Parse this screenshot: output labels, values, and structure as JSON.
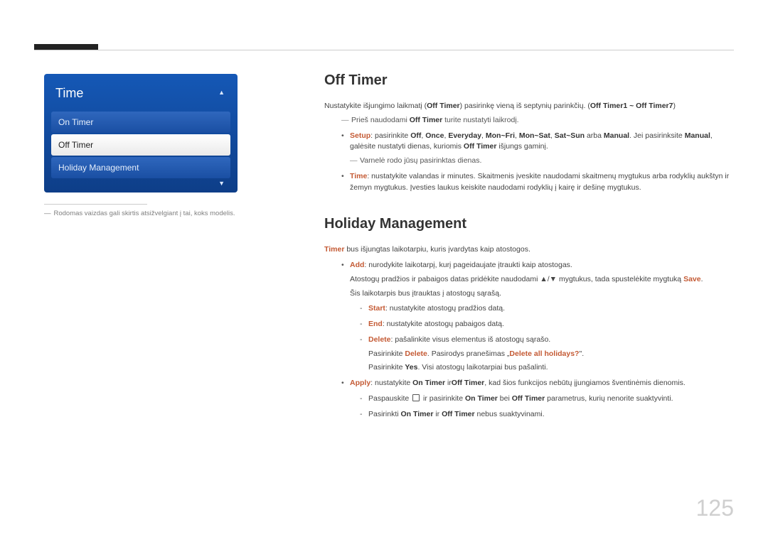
{
  "page_number": "125",
  "sidebar": {
    "panel_title": "Time",
    "items": [
      {
        "label": "On Timer",
        "selected": false
      },
      {
        "label": "Off Timer",
        "selected": true
      },
      {
        "label": "Holiday Management",
        "selected": false
      }
    ],
    "footnote": "Rodomas vaizdas gali skirtis atsižvelgiant į tai, koks modelis."
  },
  "off_timer": {
    "heading": "Off Timer",
    "intro_pre": "Nustatykite išjungimo laikmatį (",
    "intro_b1": "Off Timer",
    "intro_mid": ") pasirinkę vieną iš septynių parinkčių. (",
    "intro_b2": "Off Timer1 ~ Off Timer7",
    "intro_post": ")",
    "pre_note_pre": "Prieš naudodami ",
    "pre_note_b": "Off Timer",
    "pre_note_post": " turite nustatyti laikrodį.",
    "setup": {
      "label": "Setup",
      "t_text1": ": pasirinkite ",
      "opt_off": "Off",
      "opt_once": "Once",
      "opt_everyday": "Everyday",
      "opt_monfri": "Mon~Fri",
      "opt_monsat": "Mon~Sat",
      "opt_satsun": "Sat~Sun",
      "t_or": " arba ",
      "opt_manual": "Manual",
      "t_text2": ". Jei pasirinksite ",
      "opt_manual2": "Manual",
      "t_text3": ", galėsite nustatyti dienas, kuriomis ",
      "off_timer_b": "Off Timer",
      "t_text4": " išjungs gaminį.",
      "check_note": "Varnelė rodo jūsų pasirinktas dienas."
    },
    "time": {
      "label": "Time",
      "text": ": nustatykite valandas ir minutes. Skaitmenis įveskite naudodami skaitmenų mygtukus arba rodyklių aukštyn ir žemyn mygtukus. Įvesties laukus keiskite naudodami rodyklių į kairę ir dešinę mygtukus."
    }
  },
  "holiday": {
    "heading": "Holiday Management",
    "intro_b": "Timer",
    "intro_text": " bus išjungtas laikotarpiu, kuris įvardytas kaip atostogos.",
    "add": {
      "label": "Add",
      "text": ": nurodykite laikotarpį, kurį pageidaujate įtraukti kaip atostogas.",
      "line2_pre": "Atostogų pradžios ir pabaigos datas pridėkite naudodami ",
      "line2_mid": " mygtukus, tada spustelėkite mygtuką ",
      "line2_b": "Save",
      "line2_post": ".",
      "line3": "Šis laikotarpis bus įtrauktas į atostogų sąrašą.",
      "start_label": "Start",
      "start_text": ": nustatykite atostogų pradžios datą.",
      "end_label": "End",
      "end_text": ": nustatykite atostogų pabaigos datą.",
      "delete_label": "Delete",
      "delete_text": ": pašalinkite visus elementus iš atostogų sąrašo.",
      "delete_sub_pre": "Pasirinkite ",
      "delete_sub_b1": "Delete",
      "delete_sub_mid": ". Pasirodys pranešimas „",
      "delete_sub_b2": "Delete all holidays?",
      "delete_sub_post": "\".",
      "delete_sub2_pre": "Pasirinkite ",
      "delete_sub2_b": "Yes",
      "delete_sub2_post": ". Visi atostogų laikotarpiai bus pašalinti."
    },
    "apply": {
      "label": "Apply",
      "text_pre": ": nustatykite ",
      "on_b": "On Timer",
      "text_mid": " ir",
      "off_b": "Off Timer",
      "text_post": ", kad šios funkcijos nebūtų įjungiamos šventinėmis dienomis.",
      "sub1_pre": "Paspauskite ",
      "sub1_mid": " ir pasirinkite ",
      "sub1_on": "On Timer",
      "sub1_bei": " bei ",
      "sub1_off": "Off Timer",
      "sub1_post": " parametrus, kurių nenorite suaktyvinti.",
      "sub2_pre": "Pasirinkti ",
      "sub2_on": "On Timer",
      "sub2_ir": " ir ",
      "sub2_off": "Off Timer",
      "sub2_post": " nebus suaktyvinami."
    }
  }
}
